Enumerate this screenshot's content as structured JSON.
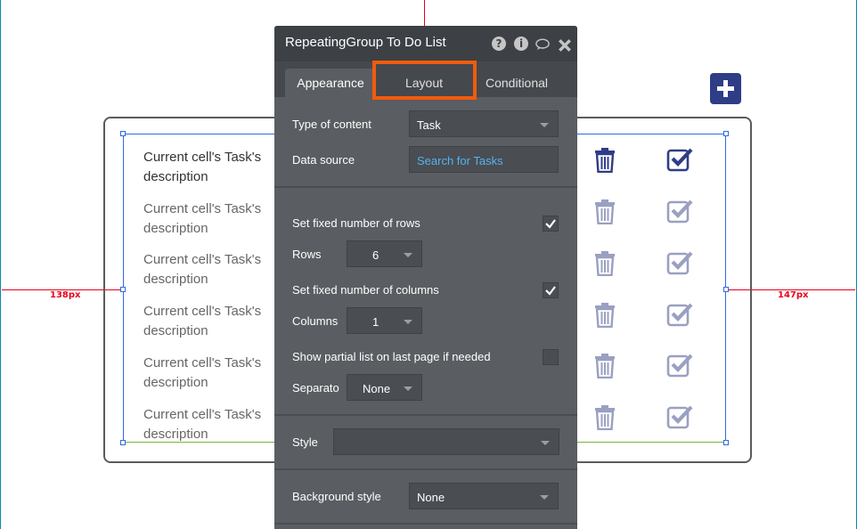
{
  "canvas": {
    "left_distance": "138px",
    "right_distance": "147px"
  },
  "group": {
    "cells": [
      {
        "text": "Current cell's Task's description"
      },
      {
        "text": "Current cell's Task's description"
      },
      {
        "text": "Current cell's Task's description"
      },
      {
        "text": "Current cell's Task's description"
      },
      {
        "text": "Current cell's Task's description"
      },
      {
        "text": "Current cell's Task's description"
      }
    ],
    "icons": {
      "delete": "trash-icon",
      "complete": "checkbox-checked-icon",
      "add": "plus-icon"
    },
    "colors": {
      "icon_active": "#2f3d86",
      "icon_inactive": "#9aa0c2"
    }
  },
  "panel": {
    "title": "RepeatingGroup To Do List",
    "title_icons": [
      "help-icon",
      "info-icon",
      "comment-icon",
      "close-icon"
    ],
    "tabs": [
      {
        "label": "Appearance",
        "active": true
      },
      {
        "label": "Layout",
        "active": false,
        "highlighted": true
      },
      {
        "label": "Conditional",
        "active": false
      }
    ],
    "type_of_content": {
      "label": "Type of content",
      "value": "Task"
    },
    "data_source": {
      "label": "Data source",
      "value": "Search for Tasks"
    },
    "fixed_rows": {
      "label": "Set fixed number of rows",
      "checked": true
    },
    "rows": {
      "label": "Rows",
      "value": "6"
    },
    "fixed_columns": {
      "label": "Set fixed number of columns",
      "checked": true
    },
    "columns": {
      "label": "Columns",
      "value": "1"
    },
    "partial_list": {
      "label": "Show partial list on last page if needed",
      "checked": false
    },
    "separator": {
      "label": "Separato",
      "value": "None"
    },
    "style": {
      "label": "Style",
      "value": ""
    },
    "background_style": {
      "label": "Background style",
      "value": "None"
    },
    "colors": {
      "highlight": "#f25b0d",
      "link": "#56b2f0"
    }
  }
}
